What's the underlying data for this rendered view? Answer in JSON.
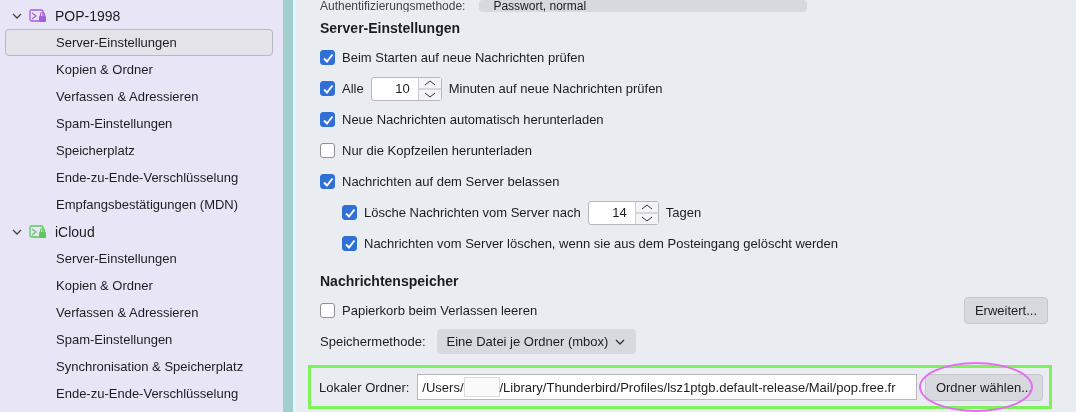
{
  "sidebar": {
    "accounts": [
      {
        "name": "POP-1998",
        "color": "#a45ee0",
        "expanded": true,
        "items": [
          {
            "label": "Server-Einstellungen",
            "selected": true
          },
          {
            "label": "Kopien & Ordner",
            "selected": false
          },
          {
            "label": "Verfassen & Adressieren",
            "selected": false
          },
          {
            "label": "Spam-Einstellungen",
            "selected": false
          },
          {
            "label": "Speicherplatz",
            "selected": false
          },
          {
            "label": "Ende-zu-Ende-Verschlüsselung",
            "selected": false
          },
          {
            "label": "Empfangsbestätigungen (MDN)",
            "selected": false
          }
        ]
      },
      {
        "name": "iCloud",
        "color": "#5cc85c",
        "expanded": true,
        "items": [
          {
            "label": "Server-Einstellungen",
            "selected": false
          },
          {
            "label": "Kopien & Ordner",
            "selected": false
          },
          {
            "label": "Verfassen & Adressieren",
            "selected": false
          },
          {
            "label": "Spam-Einstellungen",
            "selected": false
          },
          {
            "label": "Synchronisation & Speicherplatz",
            "selected": false
          },
          {
            "label": "Ende-zu-Ende-Verschlüsselung",
            "selected": false
          }
        ]
      }
    ]
  },
  "auth": {
    "label": "Authentifizierungsmethode:",
    "value": "Passwort, normal"
  },
  "server_settings": {
    "title": "Server-Einstellungen",
    "options": [
      {
        "kind": "checkbox",
        "label": "Beim Starten auf neue Nachrichten prüfen",
        "checked": true
      },
      {
        "kind": "number",
        "label": "Alle",
        "value": "10",
        "suffix": "Minuten auf neue Nachrichten prüfen",
        "checked": true
      },
      {
        "kind": "checkbox",
        "label": "Neue Nachrichten automatisch herunterladen",
        "checked": true
      },
      {
        "kind": "checkbox",
        "label": "Nur die Kopfzeilen herunterladen",
        "checked": false
      },
      {
        "kind": "checkbox",
        "label": "Nachrichten auf dem Server belassen",
        "checked": true,
        "children": [
          {
            "kind": "number",
            "label": "Lösche Nachrichten vom Server nach",
            "value": "14",
            "suffix": "Tagen",
            "checked": true
          },
          {
            "kind": "checkbox",
            "label": "Nachrichten vom Server löschen, wenn sie aus dem Posteingang gelöscht werden",
            "checked": true
          }
        ]
      }
    ]
  },
  "storage": {
    "title": "Nachrichtenspeicher",
    "empty_trash": {
      "label": "Papierkorb beim Verlassen leeren",
      "checked": false
    },
    "advanced_button": "Erweitert...",
    "method": {
      "label": "Speichermethode:",
      "value": "Eine Datei je Ordner (mbox)"
    },
    "local_folder": {
      "label": "Lokaler Ordner:",
      "path_start": "/Users/",
      "path_end": "/Library/Thunderbird/Profiles/lsz1ptgb.default-release/Mail/pop.free.fr",
      "button": "Ordner wählen..."
    }
  }
}
